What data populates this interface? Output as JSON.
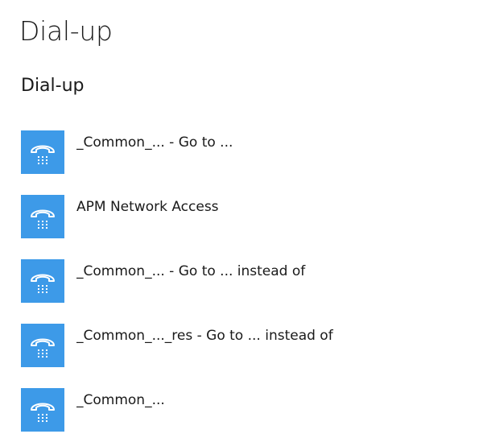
{
  "page": {
    "title": "Dial-up"
  },
  "section": {
    "title": "Dial-up"
  },
  "connections": [
    {
      "name": "_Common_... - Go to ..."
    },
    {
      "name": "APM Network Access"
    },
    {
      "name": "_Common_... - Go to ... instead of"
    },
    {
      "name": "_Common_..._res - Go to ... instead of"
    },
    {
      "name": "_Common_..."
    }
  ],
  "icons": {
    "connection": "dialup-phone-icon"
  },
  "colors": {
    "tile": "#3d9ae8",
    "icon": "#ffffff"
  }
}
